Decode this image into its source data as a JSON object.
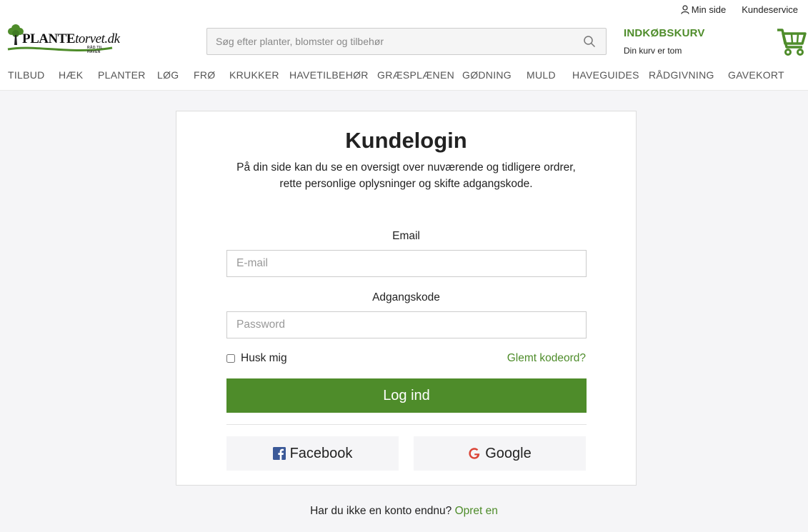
{
  "header": {
    "logo_text_main": "PLANTE",
    "logo_text_suffix": "torvet.dk",
    "logo_tagline": "RÅD TIL HAVEN",
    "util_links": {
      "my_page": "Min side",
      "customer_service": "Kundeservice"
    },
    "search": {
      "placeholder": "Søg efter planter, blomster og tilbehør",
      "value": ""
    },
    "cart": {
      "title": "INDKØBSKURV",
      "status": "Din kurv er tom"
    },
    "nav": [
      "TILBUD",
      "HÆK",
      "PLANTER",
      "LØG",
      "FRØ",
      "KRUKKER",
      "HAVETILBEHØR",
      "GRÆSPLÆNEN",
      "GØDNING",
      "MULD",
      "HAVEGUIDES",
      "RÅDGIVNING",
      "GAVEKORT"
    ]
  },
  "login": {
    "title": "Kundelogin",
    "desc_line1": "På din side kan du se en oversigt over nuværende og tidligere ordrer,",
    "desc_line2": "rette personlige oplysninger og skifte adgangskode.",
    "email_label": "Email",
    "email_placeholder": "E-mail",
    "email_value": "",
    "password_label": "Adgangskode",
    "password_placeholder": "Password",
    "password_value": "",
    "remember_label": "Husk mig",
    "remember_checked": false,
    "forgot_label": "Glemt kodeord?",
    "submit_label": "Log ind",
    "facebook_label": "Facebook",
    "google_label": "Google"
  },
  "signup": {
    "prompt": "Har du ikke en konto endnu?",
    "link": "Opret en"
  },
  "colors": {
    "accent": "#4e8c2a",
    "background": "#f5f5f7",
    "facebook": "#3b5998",
    "google": "#db4437"
  }
}
